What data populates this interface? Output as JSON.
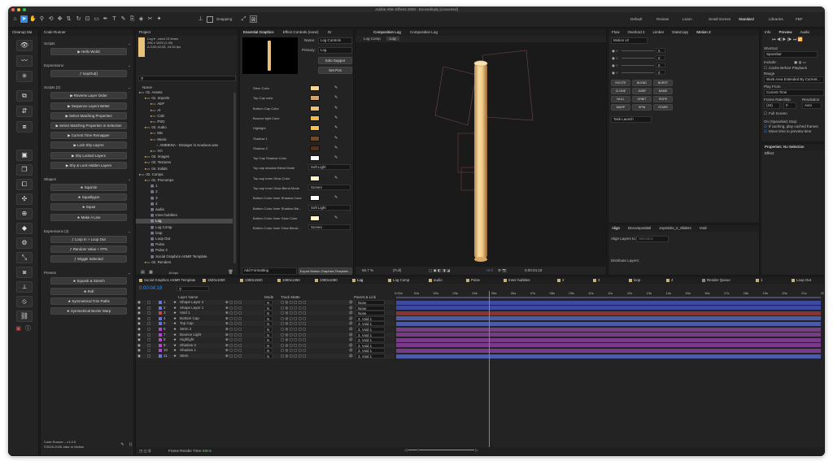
{
  "app": {
    "title": "Adobe After Effects 2020 - Exceedinply [converted]",
    "workspaces": [
      "Default",
      "Review",
      "Learn",
      "Small Screen",
      "Standard",
      "Libraries",
      "FBF"
    ],
    "active_workspace": "Standard",
    "snapping_label": "Snapping"
  },
  "cleanup_panel": {
    "tab": "Cleanup Ma"
  },
  "code_runner": {
    "tab": "Code Runner",
    "sections": [
      {
        "title": "Scripts",
        "items": [
          "▶ Hello World"
        ]
      },
      {
        "title": "Expressions",
        "items": [
          "ƒ loopOut()"
        ]
      },
      {
        "title": "Scripts (2)",
        "items": [
          "▶ Reverse Layer Order",
          "▶ Sequence Layers Better",
          "▶ Select Matching Properties",
          "▶ Select Matching Properties in Selection",
          "▶ Current Time Remapper",
          "▶ Lock Shy Layers",
          "▶ Shy Locked Layers",
          "▶ Shy & Lock Hidden Layers"
        ]
      },
      {
        "title": "Shapes",
        "items": [
          "★ Squircle",
          "★ Squallygon",
          "★ Squar",
          "★ Make A Line"
        ]
      },
      {
        "title": "Expressions (2)",
        "items": [
          "ƒ Loop In + Loop Out",
          "ƒ Random Value + FPS",
          "ƒ Wiggle Selected"
        ]
      },
      {
        "title": "Presets",
        "items": [
          "★ Squash & Stretch",
          "★ Roll",
          "★ Symmetrical Trim Paths",
          "★ Symmetrical Bezier Warp"
        ]
      }
    ],
    "footer_version": "Code Runner – v1.0.0",
    "footer_copy": "©2025-2026 Jake In Motion"
  },
  "project": {
    "tab": "Project",
    "info_line1": "Log ▾ , used 13 times",
    "info_line2": "256 x 1920 (1.00)",
    "info_line3": "Δ 0;00;22;06, 24.00 fps",
    "search_placeholder": "",
    "column_name": "Name",
    "tree": [
      {
        "depth": 0,
        "label": "01. Assets",
        "kind": "folder"
      },
      {
        "depth": 1,
        "label": "01. Imports",
        "kind": "folder"
      },
      {
        "depth": 2,
        "label": "AEP",
        "kind": "folder"
      },
      {
        "depth": 2,
        "label": "AI",
        "kind": "folder"
      },
      {
        "depth": 2,
        "label": "C4D",
        "kind": "folder"
      },
      {
        "depth": 2,
        "label": "PSD",
        "kind": "folder"
      },
      {
        "depth": 1,
        "label": "02. Audio",
        "kind": "folder"
      },
      {
        "depth": 2,
        "label": "Mix",
        "kind": "folder"
      },
      {
        "depth": 2,
        "label": "Music",
        "kind": "folder"
      },
      {
        "depth": 3,
        "label": "AMBIENA - Stranger in Kowloon.wav",
        "kind": "audio"
      },
      {
        "depth": 2,
        "label": "VO",
        "kind": "folder"
      },
      {
        "depth": 1,
        "label": "03. Images",
        "kind": "folder"
      },
      {
        "depth": 1,
        "label": "03. Textures",
        "kind": "folder"
      },
      {
        "depth": 1,
        "label": "04. Solids",
        "kind": "folder"
      },
      {
        "depth": 0,
        "label": "02. Comps",
        "kind": "folder"
      },
      {
        "depth": 1,
        "label": "01. Precomps",
        "kind": "folder"
      },
      {
        "depth": 2,
        "label": "1",
        "kind": "comp"
      },
      {
        "depth": 2,
        "label": "2",
        "kind": "comp"
      },
      {
        "depth": 2,
        "label": "3",
        "kind": "comp"
      },
      {
        "depth": 2,
        "label": "4",
        "kind": "comp"
      },
      {
        "depth": 2,
        "label": "audio",
        "kind": "comp"
      },
      {
        "depth": 2,
        "label": "Inner bubbles",
        "kind": "comp"
      },
      {
        "depth": 2,
        "label": "Log",
        "kind": "comp",
        "selected": true
      },
      {
        "depth": 2,
        "label": "Log Comp",
        "kind": "comp"
      },
      {
        "depth": 2,
        "label": "loop",
        "kind": "comp"
      },
      {
        "depth": 2,
        "label": "Loop Out",
        "kind": "comp"
      },
      {
        "depth": 2,
        "label": "Pulse",
        "kind": "comp"
      },
      {
        "depth": 2,
        "label": "Pulse 2",
        "kind": "comp"
      },
      {
        "depth": 2,
        "label": "Social Graphics ASMR Template",
        "kind": "comp"
      },
      {
        "depth": 1,
        "label": "02. Renders",
        "kind": "folder"
      }
    ],
    "bpc": "16 bpc"
  },
  "essential_graphics": {
    "tabs": [
      "Essential Graphics",
      "Effect Controls (none)",
      "Gr"
    ],
    "name_label": "Name:",
    "name_value": "Log Controls",
    "primary_label": "Primary:",
    "primary_value": "Log",
    "solo_button": "Solo Suppor",
    "setpos_button": "Set Pos",
    "properties": [
      {
        "label": "Stem Color",
        "type": "color",
        "color": "#f7d692"
      },
      {
        "label": "Top Cap color",
        "type": "color",
        "color": "#d2a56a"
      },
      {
        "label": "Bottom Cap Color",
        "type": "color",
        "color": "#f0c070"
      },
      {
        "label": "Bounce light Color",
        "type": "color",
        "color": "#f5b64a"
      },
      {
        "label": "Highlight",
        "type": "color",
        "color": "#f7c050"
      },
      {
        "label": "Shadow 1",
        "type": "color",
        "color": "#6e4a2a"
      },
      {
        "label": "Shadow 2",
        "type": "color",
        "color": "#4e301c"
      },
      {
        "label": "Top Cap Shadow Color",
        "type": "color",
        "color": "#ffffff"
      },
      {
        "label": "Top cap shadow Blend Mode",
        "type": "menu",
        "value": "Soft Light"
      },
      {
        "label": "Top cap Inner Glow Color",
        "type": "color",
        "color": "#fff4c8"
      },
      {
        "label": "Top cap Inner Glow Blend Mode",
        "type": "menu",
        "value": "Screen"
      },
      {
        "label": "Bottom Color Inner Shadow Color",
        "type": "color",
        "color": "#ffffff"
      },
      {
        "label": "Bottom Color Inner Shadow Ble...",
        "type": "menu",
        "value": "Soft Light"
      },
      {
        "label": "Bottom Color Inner Glow Color",
        "type": "color",
        "color": "#fff4c8"
      },
      {
        "label": "Bottom Color Inner Glow Blend...",
        "type": "menu",
        "value": "Screen"
      }
    ],
    "add_formatting": "Add Formatting",
    "export_button": "Export Motion Graphics Template..."
  },
  "composition": {
    "tabs": [
      "Composition Log",
      "Composition Log"
    ],
    "subtabs": [
      "Log Comp",
      "Log"
    ],
    "zoom": "66.7 %",
    "quality": "(Full)",
    "exposure": "+0.0",
    "timecode": "0:00:04:18"
  },
  "right_tools": {
    "tabs": [
      "Flow",
      "Overlord 2",
      "Limber",
      "DataCopy",
      "Motion 2"
    ],
    "motion_menu": "Motion v2",
    "slider_values": [
      "0",
      "0",
      "0",
      "0"
    ],
    "buttons": [
      "EXCITE",
      "BLEND",
      "BURST",
      "CLONE",
      "JUMP",
      "NAME",
      "NULL",
      "ORBIT",
      "ROPE",
      "WARP",
      "SPIN",
      "STARE"
    ],
    "task_launch": "Task Launch"
  },
  "preview": {
    "tabs": [
      "Info",
      "Preview",
      "Audio"
    ],
    "shortcut_label": "Shortcut",
    "shortcut_value": "Spacebar",
    "include_label": "Include:",
    "cache_label": "Cache Before Playback",
    "range_label": "Range",
    "range_value": "Work Area Extended By Current...",
    "play_from_label": "Play From",
    "play_from_value": "Current Time",
    "frame_rate_label": "Frame Rate",
    "skip_label": "Skip",
    "resolution_label": "Resolution",
    "frame_rate_value": "(24)",
    "skip_value": "0",
    "resolution_value": "Auto",
    "fullscreen_label": "Full Screen",
    "on_stop_label": "On (Spacebar) Stop:",
    "if_caching_label": "If caching, play cached frames",
    "move_time_label": "Move time to preview time",
    "properties_tab": "Properties: No Selection",
    "effects_tab": "Effect"
  },
  "align": {
    "tabs": [
      "Align",
      "Decompositeil",
      "Joysticks_n_Sliders",
      "Void"
    ],
    "align_to_label": "Align Layers to:",
    "align_to_value": "Selection",
    "distribute_label": "Distribute Layers:"
  },
  "timeline": {
    "tabs": [
      "Social Graphics ASMR Template",
      "1920x1080",
      "1080x1920",
      "1080x1350",
      "1080x1080",
      "Log",
      "Log Comp",
      "audio",
      "Pulse",
      "Inner bubbles",
      "2",
      "3",
      "loop",
      "4",
      "Render Queue",
      "1",
      "Loop Out",
      "Pulse 2"
    ],
    "active_tab": "Log",
    "timecode": "0:00:04:18",
    "col_layer_name": "Layer Name",
    "col_mode": "Mode",
    "col_trkmat": "Track Matte",
    "col_parent": "Parent & Link",
    "time_markers": [
      "0:00s",
      "01s",
      "02s",
      "03s",
      "04s",
      "05s",
      "06s",
      "07s",
      "08s",
      "09s",
      "10s",
      "11s",
      "12s",
      "13s",
      "14s",
      "15s",
      "16s",
      "17s",
      "18s",
      "19s",
      "20s",
      "21s",
      "22s"
    ],
    "layers": [
      {
        "num": "1",
        "name": "Shape Layer 2",
        "color": "#6a74d4",
        "mode": "N",
        "parent": "None",
        "bar": "#3e4aa0"
      },
      {
        "num": "2",
        "name": "Shape Layer 1",
        "color": "#6a74d4",
        "mode": "N",
        "parent": "None",
        "bar": "#3e4aa0"
      },
      {
        "num": "3",
        "name": "Void 1",
        "color": "#c24a4a",
        "mode": "N",
        "parent": "None",
        "bar": "#8c3232"
      },
      {
        "num": "4",
        "name": "Bottom Cap",
        "color": "#6a74d4",
        "mode": "N",
        "parent": "3. Void 1",
        "bar": "#4c5aa8"
      },
      {
        "num": "5",
        "name": "Top Cap",
        "color": "#6a74d4",
        "mode": "N",
        "parent": "3. Void 1",
        "bar": "#4c5aa8"
      },
      {
        "num": "6",
        "name": "Stem 2",
        "color": "#b04ac8",
        "mode": "N",
        "parent": "3. Void 1",
        "bar": "#7a3a8a"
      },
      {
        "num": "7",
        "name": "Bounce Light",
        "color": "#b04ac8",
        "mode": "N",
        "parent": "3. Void 1",
        "bar": "#7a3a8a"
      },
      {
        "num": "8",
        "name": "Highlight",
        "color": "#b04ac8",
        "mode": "N",
        "parent": "3. Void 1",
        "bar": "#7a3a8a"
      },
      {
        "num": "9",
        "name": "Shadow 2",
        "color": "#b04ac8",
        "mode": "N",
        "parent": "3. Void 1",
        "bar": "#7a3a8a"
      },
      {
        "num": "10",
        "name": "Shadow 1",
        "color": "#b04ac8",
        "mode": "N",
        "parent": "3. Void 1",
        "bar": "#7a3a8a"
      },
      {
        "num": "11",
        "name": "Stem",
        "color": "#6a74d4",
        "mode": "N",
        "parent": "3. Void 1",
        "bar": "#4c5aa8"
      }
    ],
    "playhead_fraction": 0.217,
    "frame_render_label": "Frame Render Time:",
    "frame_render_value": "69ms"
  },
  "colors": {
    "accent_blue": "#2d8ceb",
    "playhead": "#4a90e2",
    "log_gold": "#e8c27a"
  }
}
